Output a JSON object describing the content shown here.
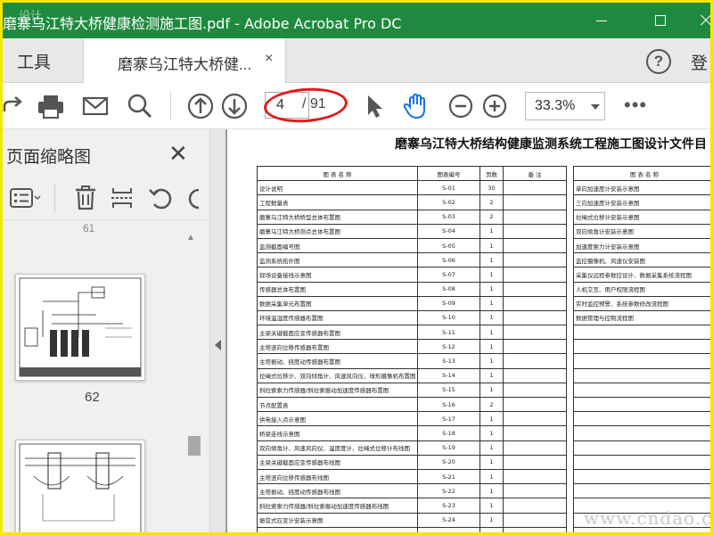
{
  "window": {
    "title": "磨寨乌江特大桥健康检测施工图.pdf - Adobe Acrobat Pro DC",
    "watermark": "设计"
  },
  "tabs": {
    "tools_label": "工具",
    "doc_label": "磨寨乌江特大桥健...",
    "close_glyph": "×",
    "signin_label": "登"
  },
  "toolbar": {
    "page_current": "4",
    "page_total": "/ 91",
    "zoom": "33.3%",
    "more": "•••",
    "icons": [
      "share-icon",
      "print-icon",
      "mail-icon",
      "search-icon",
      "page-up-icon",
      "page-down-icon",
      "select-cursor-icon",
      "hand-tool-icon",
      "zoom-out-icon",
      "zoom-in-icon"
    ]
  },
  "left_pane": {
    "title": "页面缩略图",
    "close_glyph": "✕",
    "prev_label": "61",
    "thumb_label_1": "62",
    "scroll_arrow": "▲"
  },
  "document": {
    "title": "磨寨乌江特大桥结构健康监测系统工程施工图设计文件目",
    "headers": [
      "图 表 名 称",
      "图表编号",
      "页数",
      "备 注"
    ],
    "rows": [
      [
        "设计说明",
        "S-01",
        "30",
        ""
      ],
      [
        "工程数量表",
        "S-02",
        "2",
        ""
      ],
      [
        "磨寨乌江特大桥桥型总体布置图",
        "S-03",
        "2",
        ""
      ],
      [
        "磨寨乌江特大桥测点总体布置图",
        "S-04",
        "1",
        ""
      ],
      [
        "监测截面编号图",
        "S-05",
        "1",
        ""
      ],
      [
        "监测系统拓扑图",
        "S-06",
        "1",
        ""
      ],
      [
        "现场设备接线示意图",
        "S-07",
        "1",
        ""
      ],
      [
        "传感器总体布置图",
        "S-08",
        "1",
        ""
      ],
      [
        "数据采集单元布置图",
        "S-09",
        "1",
        ""
      ],
      [
        "环境温湿度传感器布置图",
        "S-10",
        "1",
        ""
      ],
      [
        "主梁关键截面应变传感器布置图",
        "S-11",
        "1",
        ""
      ],
      [
        "主塔竖向位移传感器布置图",
        "S-12",
        "1",
        ""
      ],
      [
        "主塔振动、挠度动传感器布置图",
        "S-13",
        "1",
        ""
      ],
      [
        "拉绳式位移计、双向倾角计、风速风向仪、球形摄像机布置图",
        "S-14",
        "1",
        ""
      ],
      [
        "斜拉索索力传感器/斜拉索振动加速度传感器布置图",
        "S-15",
        "1",
        ""
      ],
      [
        "节点配置表",
        "S-16",
        "2",
        ""
      ],
      [
        "供电接入点示意图",
        "S-17",
        "1",
        ""
      ],
      [
        "桥梁走线示意图",
        "S-18",
        "1",
        ""
      ],
      [
        "双向倾角计、风速风向仪、温度度计、拉绳式位移计布线图",
        "S-19",
        "1",
        ""
      ],
      [
        "主梁关键截面应变传感器布线图",
        "S-20",
        "1",
        ""
      ],
      [
        "主塔竖向位移传感器布线图",
        "S-21",
        "1",
        ""
      ],
      [
        "主塔振动、挠度动传感器布线图",
        "S-22",
        "1",
        ""
      ],
      [
        "斜拉索索力传感器/斜拉索振动加速度传感器布线图",
        "S-23",
        "1",
        ""
      ],
      [
        "振弦式应变计安装示意图",
        "S-24",
        "1",
        ""
      ],
      [
        "",
        "",
        "",
        ""
      ]
    ],
    "right_header": "图 表 名 称",
    "right_rows": [
      "单向加速度计安装示意图",
      "三向加速度计安装示意图",
      "拉绳式位移计安装示意图",
      "双向倾角计安装示意图",
      "加速度索力计安装示意图",
      "监控摄像机、风速仪安装图",
      "采集仪远程参数控设计、数据采集系统流程图",
      "人机交互、用户权限流程图",
      "实时监控预警、系统参数修改流程图",
      "数据管理与控制流程图",
      "",
      "",
      "",
      "",
      "",
      "",
      "",
      "",
      "",
      "",
      "",
      "",
      "",
      "",
      ""
    ]
  },
  "site_watermark": "www.cndao.com"
}
